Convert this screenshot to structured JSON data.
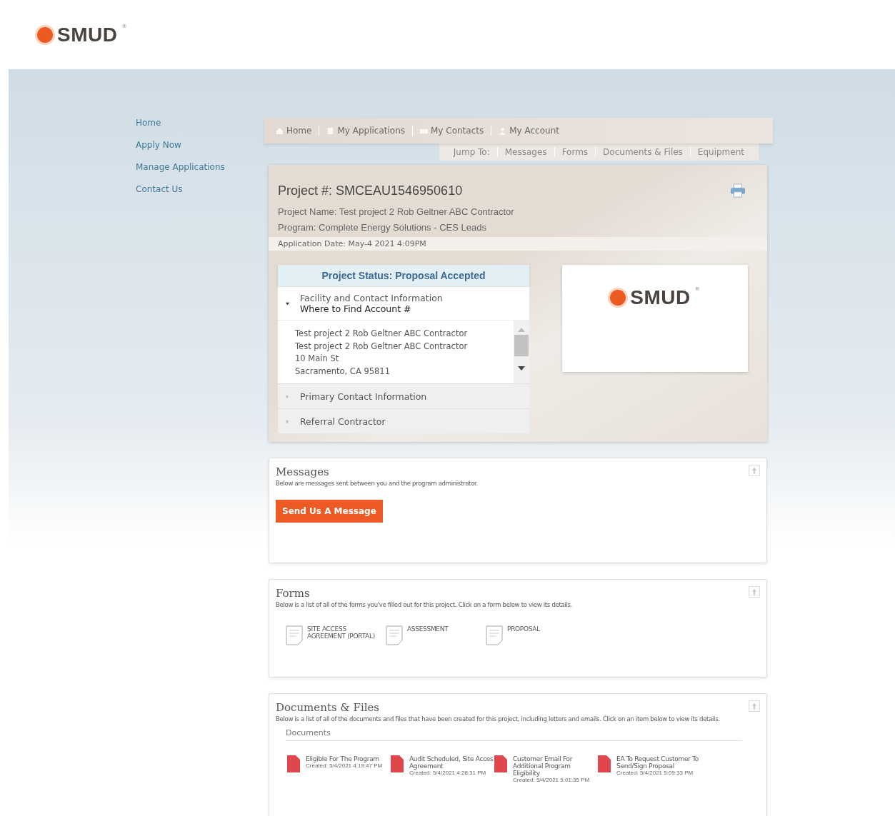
{
  "logo": {
    "text": "SMUD",
    "mark": "®"
  },
  "sidebar": {
    "items": [
      {
        "label": "Home"
      },
      {
        "label": "Apply Now"
      },
      {
        "label": "Manage Applications"
      },
      {
        "label": "Contact Us"
      }
    ]
  },
  "nav": {
    "tabs": [
      {
        "label": "Home",
        "kind": "home"
      },
      {
        "label": "My Applications",
        "kind": "doc"
      },
      {
        "label": "My Contacts",
        "kind": "contacts"
      },
      {
        "label": "My Account",
        "kind": "person"
      }
    ],
    "jump_label": "Jump To:",
    "jump_links": [
      "Messages",
      "Forms",
      "Documents & Files",
      "Equipment"
    ]
  },
  "project": {
    "number": "Project #: SMCEAU1546950610",
    "name": "Project Name: Test project 2 Rob Geltner ABC Contractor",
    "program": "Program: Complete Energy Solutions - CES Leads",
    "date": "Application Date: May-4 2021 4:09PM",
    "status": "Project Status: Proposal Accepted",
    "sections": [
      {
        "title": "Facility and Contact Information",
        "subtitle": "Where to Find Account #",
        "expanded": true,
        "lines": [
          "Test project 2 Rob Geltner ABC Contractor",
          "Test project 2 Rob Geltner ABC Contractor",
          "10 Main St",
          "Sacramento, CA 95811"
        ]
      },
      {
        "title": "Primary Contact Information",
        "expanded": false
      },
      {
        "title": "Referral Contractor",
        "expanded": false
      }
    ],
    "logo_card": {
      "text": "SMUD",
      "mark": "®"
    }
  },
  "messages": {
    "title": "Messages",
    "description": "Below are messages sent between you and the program administrator.",
    "button": "Send Us A Message"
  },
  "forms": {
    "title": "Forms",
    "description": "Below is a list of all of the forms you've filled out for this project. Click on a form below to view its details.",
    "items": [
      "SITE ACCESS AGREEMENT (PORTAL)",
      "ASSESSMENT",
      "PROPOSAL"
    ]
  },
  "documents": {
    "title": "Documents & Files",
    "description": "Below is a list of all of the documents and files that have been created for this project, including letters and emails. Click on an item below to view its details.",
    "group": "Documents",
    "items": [
      {
        "name": "Eligible For The Program",
        "created": "Created: 5/4/2021 4:19:47 PM"
      },
      {
        "name": "Audit Scheduled, Site Acces Agreement",
        "created": "Created: 5/4/2021 4:28:31 PM"
      },
      {
        "name": "Customer Email For Additional Program Eligibility",
        "created": "Created: 5/4/2021 5:01:35 PM"
      },
      {
        "name": "EA To Request Customer To Send/Sign Proposal",
        "created": "Created: 5/4/2021 5:09:33 PM"
      }
    ]
  }
}
